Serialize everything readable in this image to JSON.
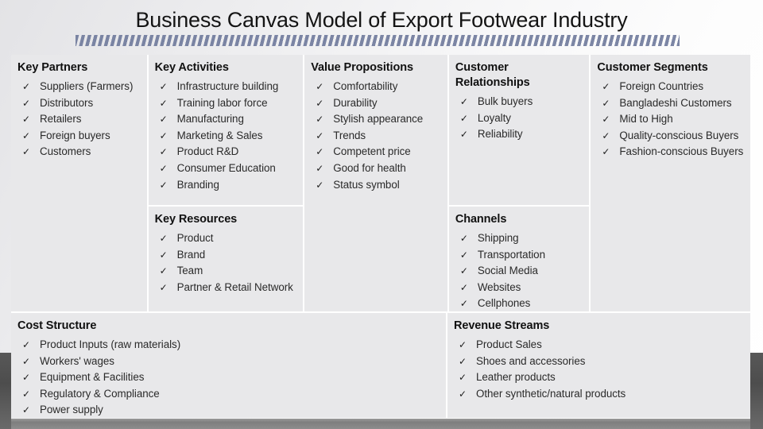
{
  "slide": {
    "title": "Business Canvas Model of Export Footwear Industry",
    "accent_color": "#6b7699",
    "cell_background": "#e8e8ea"
  },
  "icons": {
    "check": "✓"
  },
  "canvas": {
    "key_partners": {
      "header": "Key Partners",
      "items": [
        "Suppliers (Farmers)",
        "Distributors",
        "Retailers",
        "Foreign buyers",
        "Customers"
      ]
    },
    "key_activities": {
      "header": "Key Activities",
      "items": [
        "Infrastructure building",
        "Training labor force",
        "Manufacturing",
        "Marketing & Sales",
        "Product R&D",
        "Consumer Education",
        "Branding"
      ]
    },
    "key_resources": {
      "header": "Key Resources",
      "items": [
        "Product",
        "Brand",
        "Team",
        "Partner & Retail Network"
      ]
    },
    "value_propositions": {
      "header": "Value Propositions",
      "items": [
        "Comfortability",
        "Durability",
        "Stylish appearance",
        "Trends",
        "Competent price",
        "Good for health",
        "Status symbol"
      ]
    },
    "customer_relationships": {
      "header": "Customer Relationships",
      "items": [
        "Bulk buyers",
        "Loyalty",
        "Reliability"
      ]
    },
    "channels": {
      "header": "Channels",
      "items": [
        "Shipping",
        "Transportation",
        "Social Media",
        "Websites",
        "Cellphones"
      ]
    },
    "customer_segments": {
      "header": "Customer Segments",
      "items": [
        "Foreign Countries",
        "Bangladeshi Customers",
        "Mid to High",
        "Quality-conscious Buyers",
        "Fashion-conscious Buyers"
      ]
    },
    "cost_structure": {
      "header": "Cost Structure",
      "items": [
        "Product Inputs (raw materials)",
        "Workers' wages",
        "Equipment & Facilities",
        "Regulatory & Compliance",
        "Power supply"
      ]
    },
    "revenue_streams": {
      "header": "Revenue Streams",
      "items": [
        "Product Sales",
        "Shoes and accessories",
        "Leather products",
        "Other synthetic/natural products"
      ]
    }
  }
}
